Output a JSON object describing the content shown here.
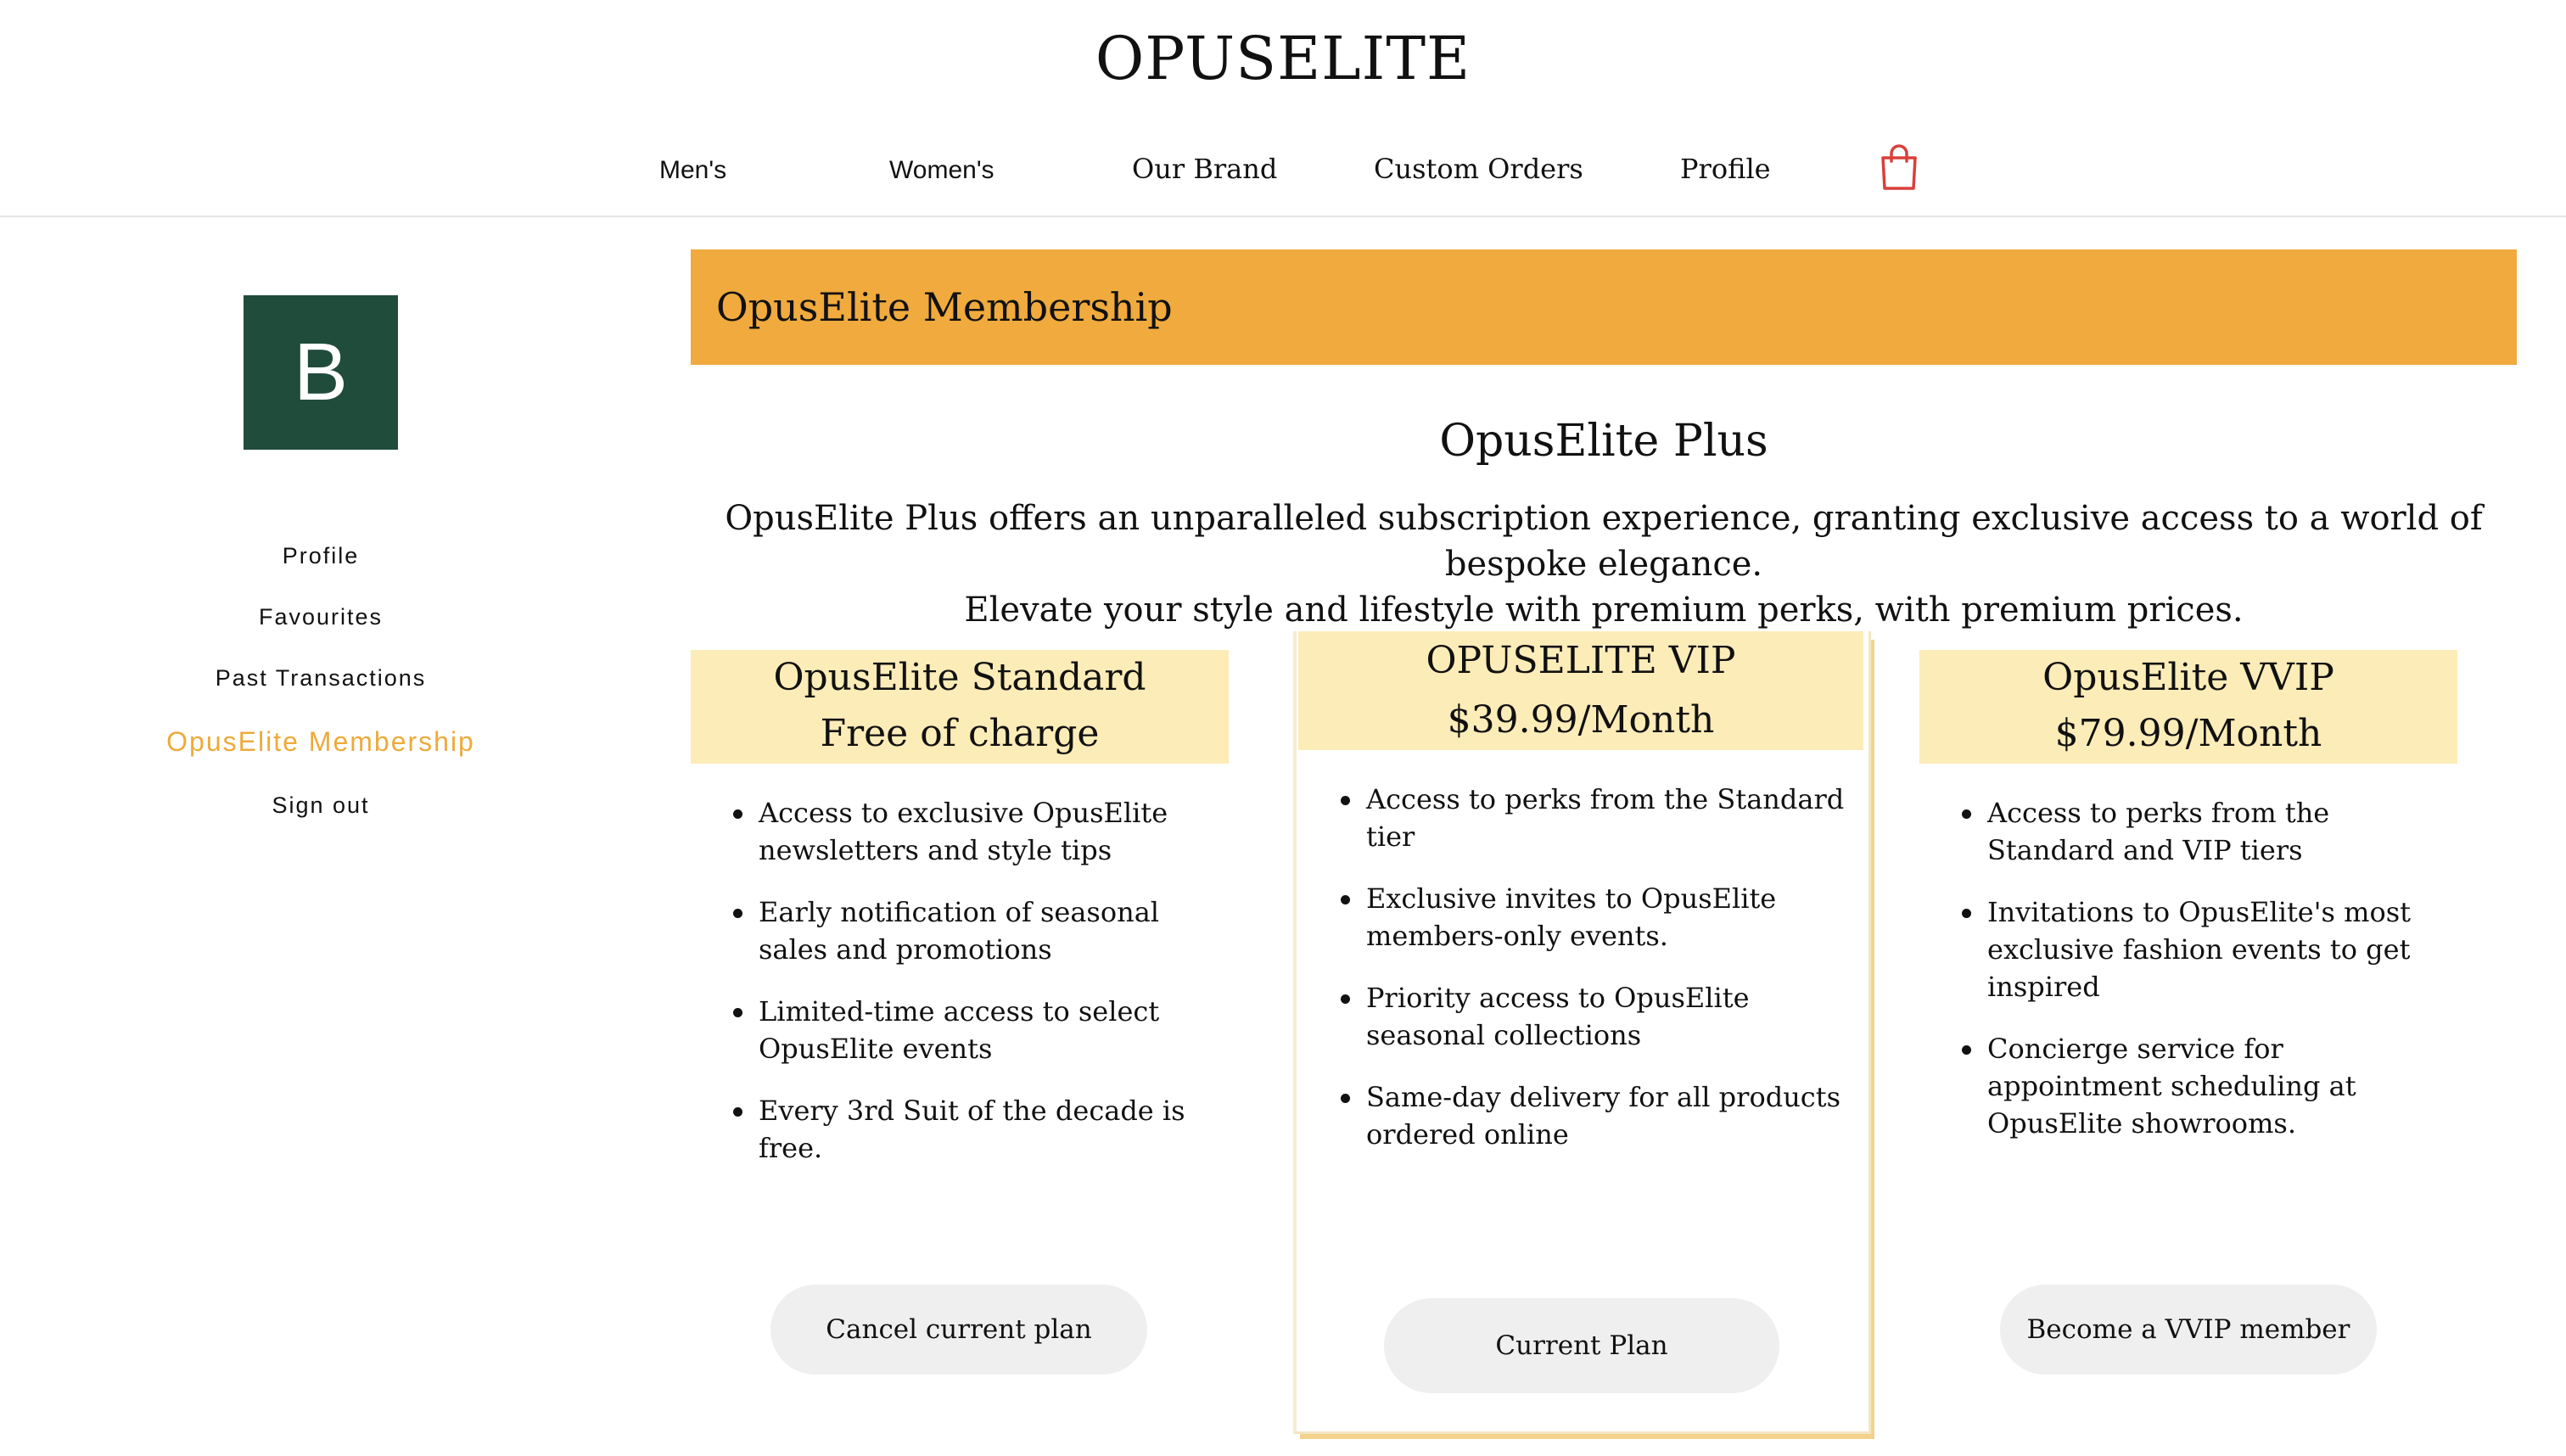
{
  "header": {
    "brand": "OPUSELITE",
    "nav": [
      "Men's",
      "Women's",
      "Our Brand",
      "Custom Orders",
      "Profile"
    ],
    "cart_icon": "shopping-bag-icon",
    "cart_color": "#d9403a"
  },
  "sidebar": {
    "avatar_letter": "B",
    "avatar_color": "#204c3c",
    "items": [
      "Profile",
      "Favourites",
      "Past Transactions",
      "OpusElite Membership",
      "Sign out"
    ],
    "active_item": "OpusElite Membership",
    "active_color": "#eeaa3a"
  },
  "main": {
    "banner_title": "OpusElite Membership",
    "banner_color": "#f0aa3d",
    "section_title": "OpusElite Plus",
    "description_line1": "OpusElite Plus offers an unparalleled subscription experience, granting exclusive access to a world of bespoke elegance.",
    "description_line2": "Elevate your style and lifestyle with premium perks, with premium prices.",
    "plans": [
      {
        "name": "OpusElite Standard",
        "price": "Free of charge",
        "perks": [
          "Access to exclusive OpusElite newsletters and style tips",
          "Early notification of seasonal sales and promotions",
          "Limited-time access to select OpusElite events",
          "Every 3rd Suit of the decade is free."
        ],
        "button": "Cancel current plan"
      },
      {
        "name": "OPUSELITE VIP",
        "price": "$39.99/Month",
        "perks": [
          "Access to perks from the Standard tier",
          "Exclusive invites to OpusElite members-only events.",
          "Priority access to OpusElite seasonal collections",
          "Same-day delivery for all products ordered online"
        ],
        "button": "Current Plan"
      },
      {
        "name": "OpusElite VVIP",
        "price": "$79.99/Month",
        "perks": [
          "Access to perks from the Standard and VIP tiers",
          "Invitations to OpusElite's most exclusive fashion events to get inspired",
          "Concierge service for appointment scheduling at OpusElite showrooms."
        ],
        "button": "Become a VVIP member"
      }
    ],
    "plan_header_color": "#fcecb8"
  }
}
